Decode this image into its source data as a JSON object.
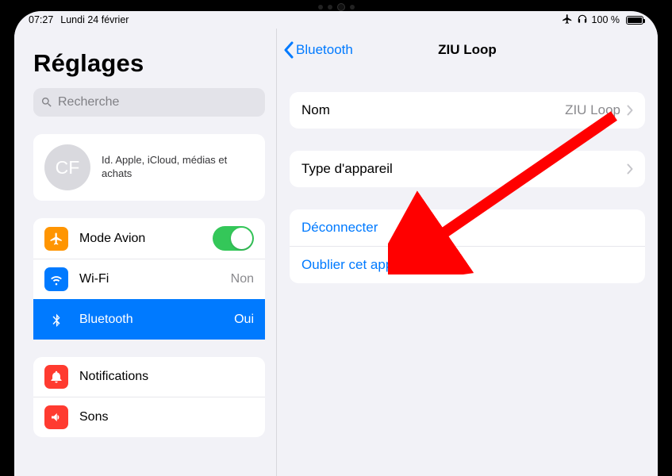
{
  "statusbar": {
    "time": "07:27",
    "date": "Lundi 24 février",
    "battery_pct": "100 %"
  },
  "sidebar": {
    "title": "Réglages",
    "search_placeholder": "Recherche",
    "profile": {
      "initials": "CF",
      "subtitle": "Id. Apple, iCloud, médias et achats"
    },
    "items": {
      "airplane": {
        "label": "Mode Avion"
      },
      "wifi": {
        "label": "Wi-Fi",
        "value": "Non"
      },
      "bluetooth": {
        "label": "Bluetooth",
        "value": "Oui"
      },
      "notifications": {
        "label": "Notifications"
      },
      "sounds": {
        "label": "Sons"
      }
    }
  },
  "detail": {
    "back_label": "Bluetooth",
    "title": "ZIU Loop",
    "name_row": {
      "label": "Nom",
      "value": "ZIU Loop"
    },
    "type_row": {
      "label": "Type d'appareil"
    },
    "disconnect": "Déconnecter",
    "forget": "Oublier cet appareil"
  }
}
